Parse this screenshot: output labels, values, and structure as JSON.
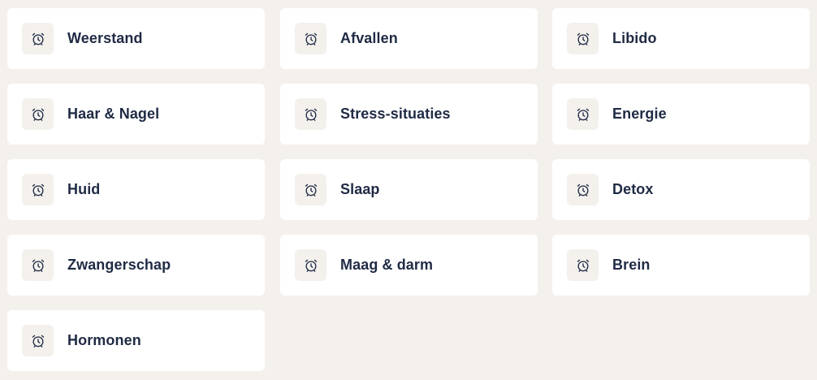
{
  "categories": [
    {
      "label": "Weerstand",
      "icon": "alarm-clock-icon"
    },
    {
      "label": "Afvallen",
      "icon": "alarm-clock-icon"
    },
    {
      "label": "Libido",
      "icon": "alarm-clock-icon"
    },
    {
      "label": "Haar & Nagel",
      "icon": "alarm-clock-icon"
    },
    {
      "label": "Stress-situaties",
      "icon": "alarm-clock-icon"
    },
    {
      "label": "Energie",
      "icon": "alarm-clock-icon"
    },
    {
      "label": "Huid",
      "icon": "alarm-clock-icon"
    },
    {
      "label": "Slaap",
      "icon": "alarm-clock-icon"
    },
    {
      "label": "Detox",
      "icon": "alarm-clock-icon"
    },
    {
      "label": "Zwangerschap",
      "icon": "alarm-clock-icon"
    },
    {
      "label": "Maag & darm",
      "icon": "alarm-clock-icon"
    },
    {
      "label": "Brein",
      "icon": "alarm-clock-icon"
    },
    {
      "label": "Hormonen",
      "icon": "alarm-clock-icon"
    }
  ],
  "colors": {
    "page_background": "#f4f1ed",
    "card_background": "#ffffff",
    "icon_background": "#f4f1ed",
    "text": "#1f2a44"
  }
}
